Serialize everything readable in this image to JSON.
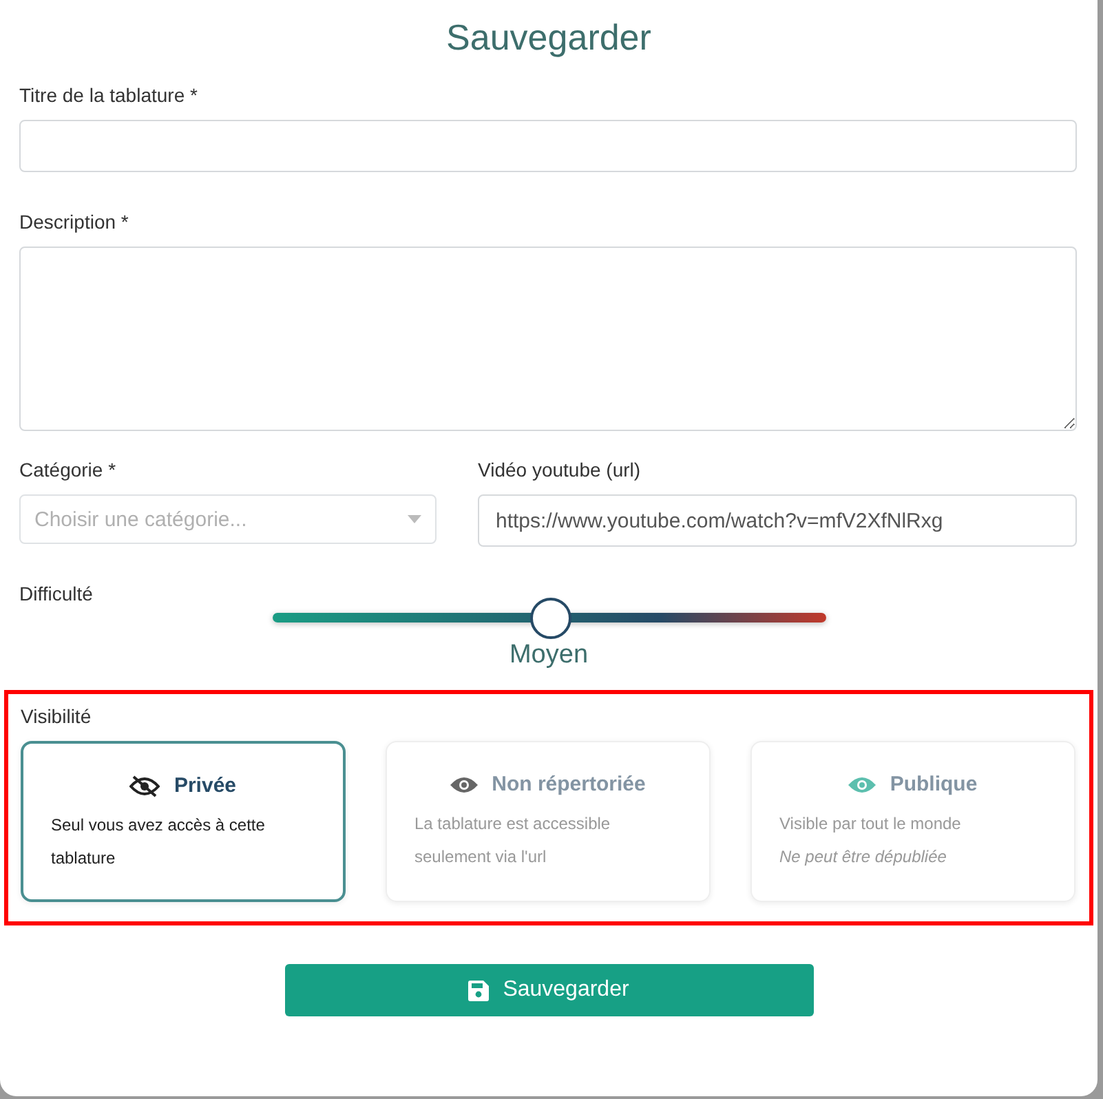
{
  "dialog": {
    "title": "Sauvegarder"
  },
  "fields": {
    "title": {
      "label": "Titre de la tablature *"
    },
    "description": {
      "label": "Description *"
    },
    "category": {
      "label": "Catégorie *",
      "placeholder": "Choisir une catégorie..."
    },
    "video": {
      "label": "Vidéo youtube (url)",
      "value": "https://www.youtube.com/watch?v=mfV2XfNlRxg"
    }
  },
  "difficulty": {
    "label": "Difficulté",
    "level": 0.5,
    "reading": "Moyen"
  },
  "visibility": {
    "label": "Visibilité",
    "highlighted": true,
    "options": [
      {
        "kind": "hidden",
        "title": "Privée",
        "lines": [
          "Seul vous avez accès à cette tablature"
        ],
        "selected": true
      },
      {
        "kind": "unlisted",
        "title": "Non répertoriée",
        "lines": [
          "La tablature est accessible seulement via l'url"
        ],
        "selected": false
      },
      {
        "kind": "public",
        "title": "Publique",
        "lines": [
          "Visible par tout le monde"
        ],
        "note": "Ne peut être dépubliée",
        "selected": false
      }
    ]
  },
  "save_button": {
    "label": "Sauvegarder"
  }
}
